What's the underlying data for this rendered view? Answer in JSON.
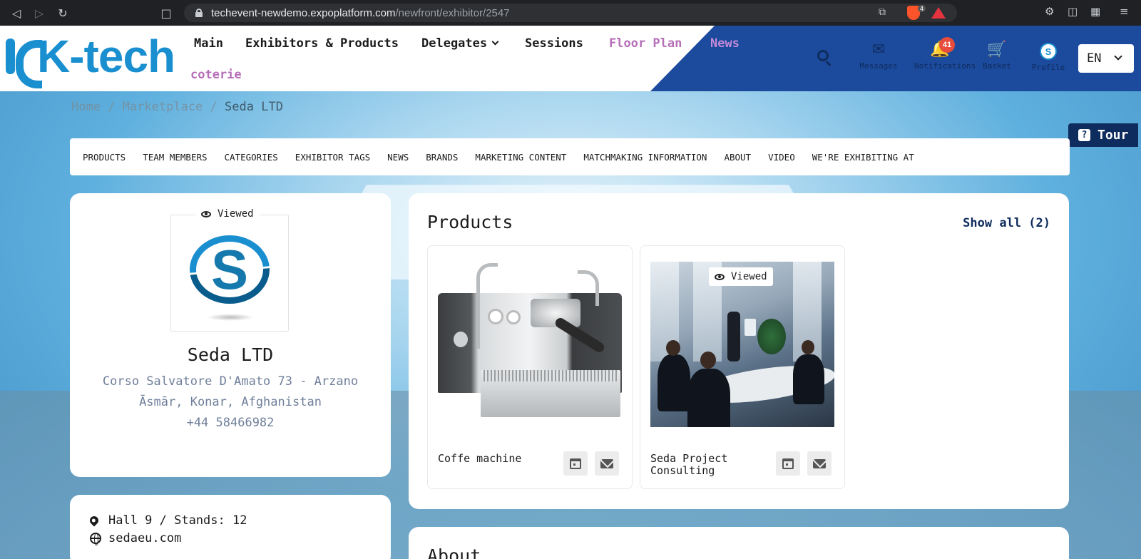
{
  "browser": {
    "url_domain": "techevent-newdemo.expoplatform.com",
    "url_path": "/newfront/exhibitor/2547",
    "shield_count": "4"
  },
  "header": {
    "logo_text": "K-tech",
    "nav": {
      "main": "Main",
      "exhibitors": "Exhibitors & Products",
      "delegates": "Delegates",
      "sessions": "Sessions",
      "floor_plan": "Floor Plan",
      "news": "News",
      "coterie": "coterie"
    },
    "icons": {
      "messages": "Messages",
      "notifications": "Notifications",
      "basket": "Basket",
      "profile": "Profile",
      "notification_count": "41"
    },
    "language": "EN"
  },
  "breadcrumb": {
    "home": "Home",
    "marketplace": "Marketplace",
    "current": "Seda LTD",
    "sep": "/"
  },
  "tour_label": "Tour",
  "tabs": [
    "PRODUCTS",
    "TEAM MEMBERS",
    "CATEGORIES",
    "EXHIBITOR TAGS",
    "NEWS",
    "BRANDS",
    "MARKETING CONTENT",
    "MATCHMAKING INFORMATION",
    "ABOUT",
    "VIDEO",
    "WE'RE EXHIBITING AT"
  ],
  "exhibitor": {
    "viewed_label": "Viewed",
    "name": "Seda LTD",
    "address_line1": "Corso Salvatore D'Amato 73 - Arzano",
    "address_line2": "Āsmār, Konar, Afghanistan",
    "phone": "+44 58466982",
    "hall": "Hall 9 / Stands: 12",
    "website": "sedaeu.com"
  },
  "products": {
    "title": "Products",
    "show_all": "Show all (2)",
    "items": [
      {
        "name": "Coffe machine"
      },
      {
        "name": "Seda Project Consulting",
        "viewed_label": "Viewed"
      }
    ]
  },
  "about_title": "About",
  "colors": {
    "brand_blue": "#1a8fd0",
    "header_panel": "#1c4a9c",
    "navy": "#0f2c5e",
    "purple_link": "#b56fb8",
    "badge_red": "#e74c3c"
  }
}
